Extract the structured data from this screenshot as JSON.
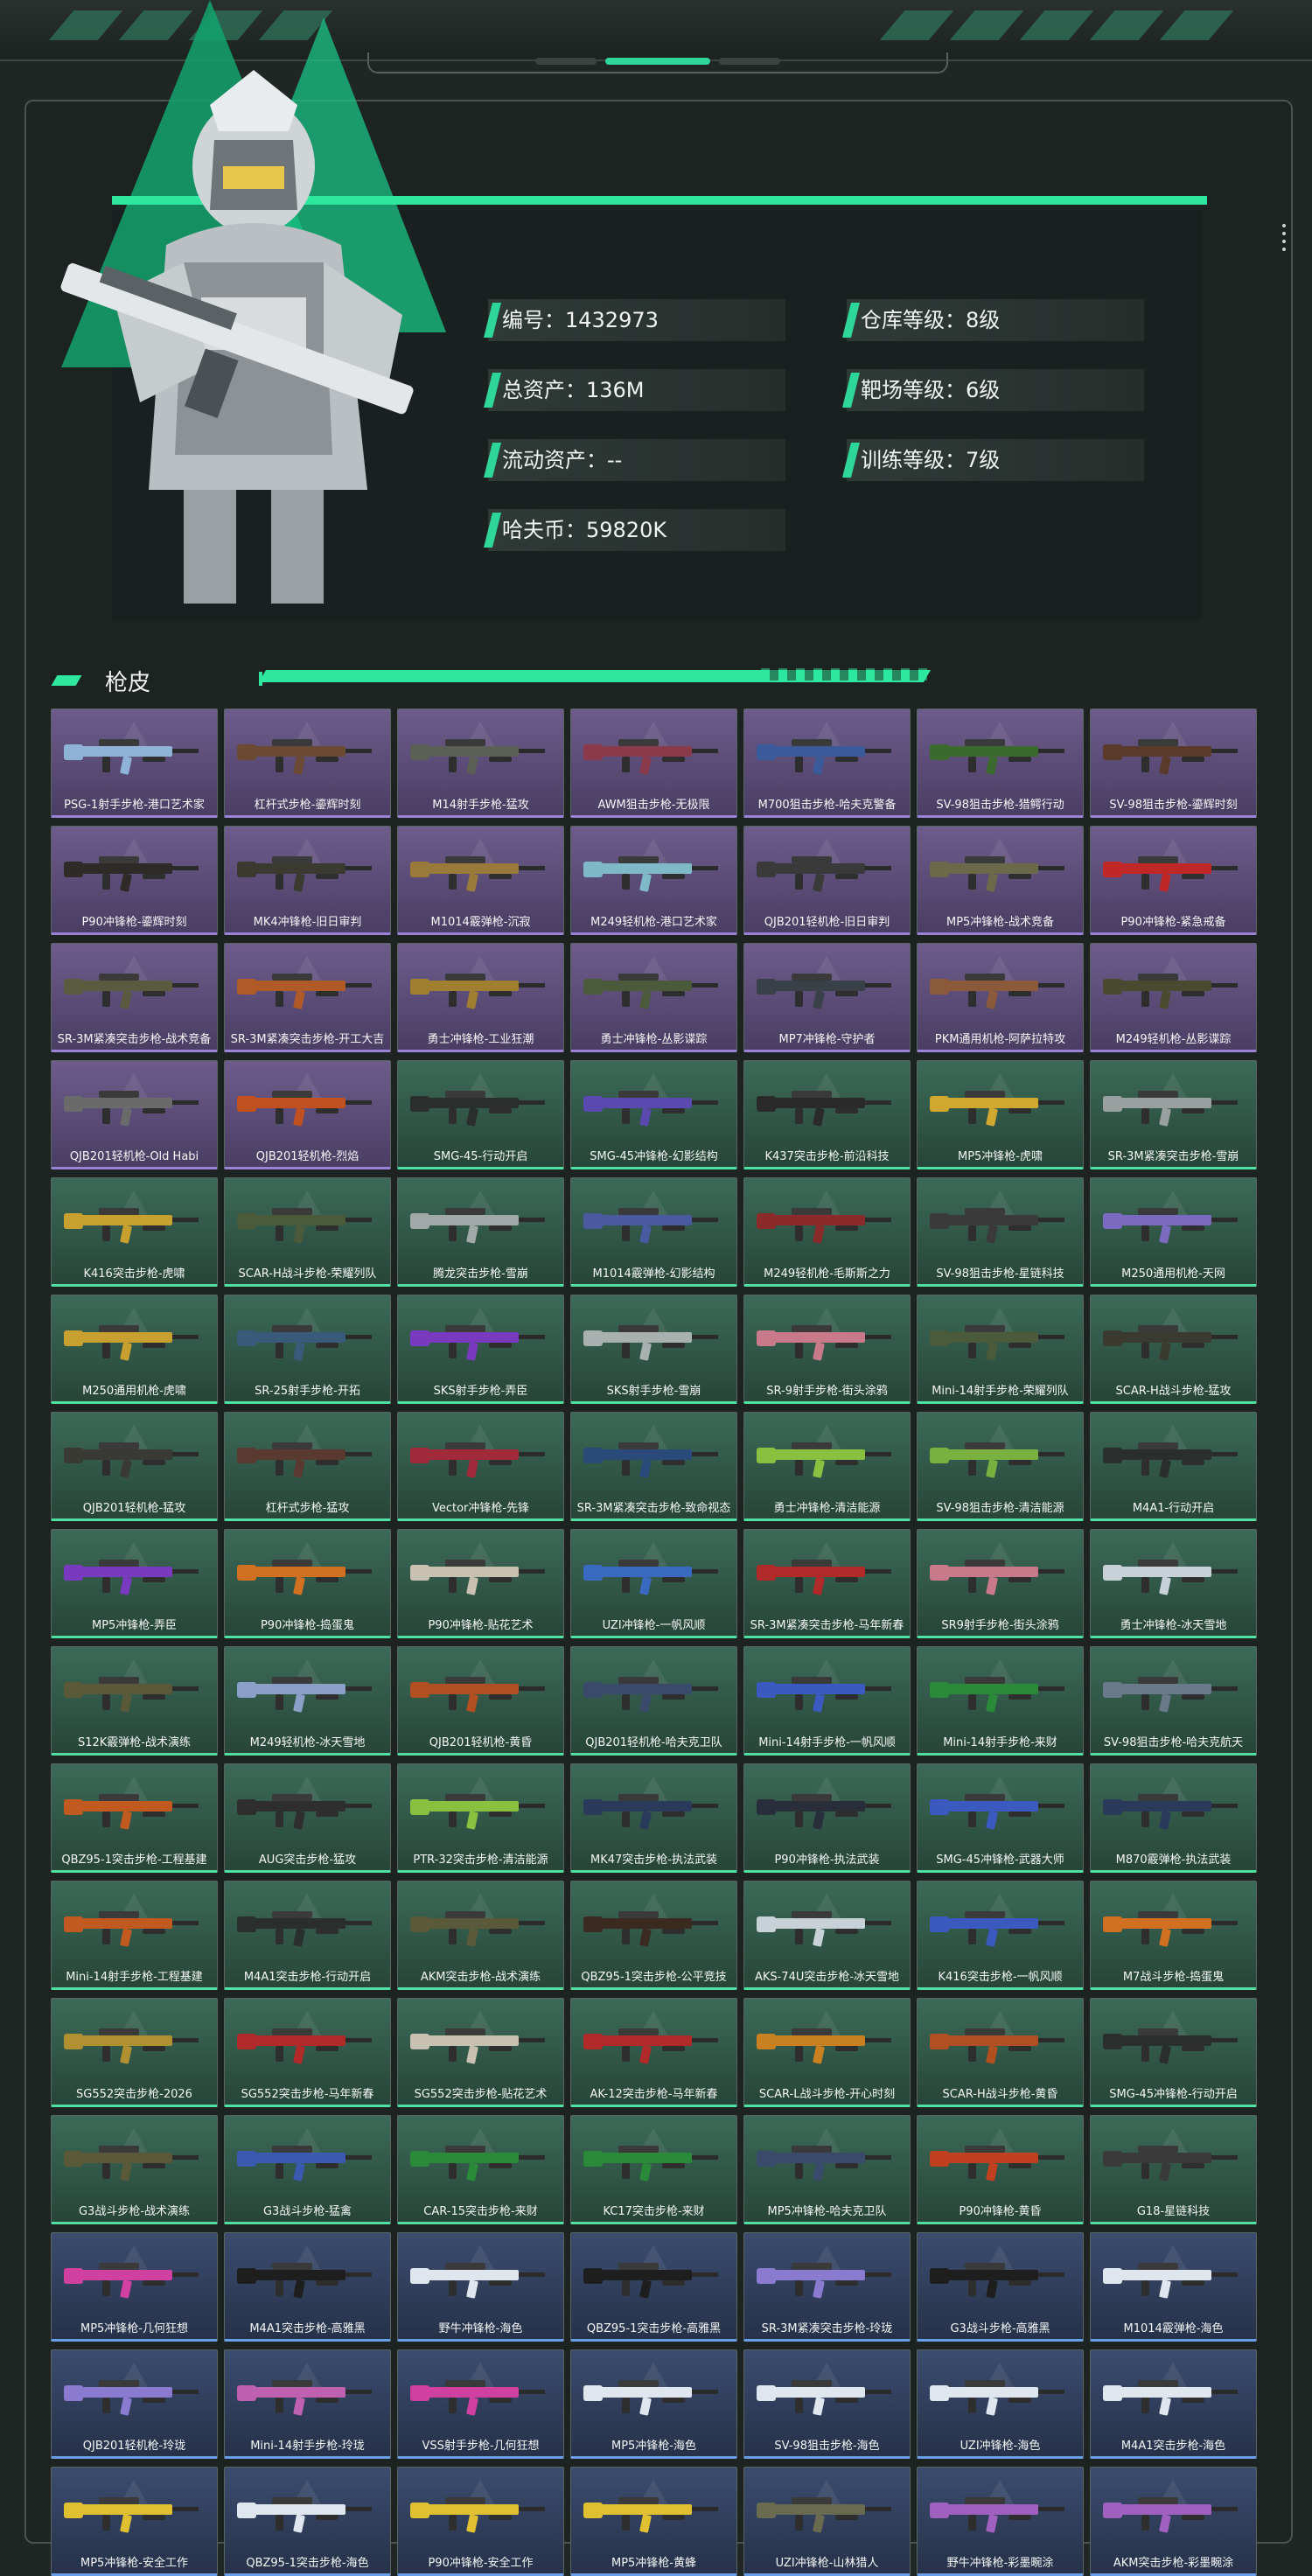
{
  "profile": {
    "id_label": "编号：1432973",
    "total_assets_label": "总资产：136M",
    "liquid_assets_label": "流动资产：--",
    "hafu_coin_label": "哈夫币：59820K",
    "warehouse_level_label": "仓库等级：8级",
    "range_level_label": "靶场等级：6级",
    "training_level_label": "训练等级：7级"
  },
  "section": {
    "title": "枪皮"
  },
  "colors": {
    "accent": "#2ee8a0",
    "purple_card": "#6d5c8c",
    "green_card": "#3c6a58",
    "blue_card": "#3b4c6e"
  },
  "skins": [
    {
      "name": "PSG-1射手步枪-港口艺术家",
      "rarity": "purple",
      "color": "#8fb3d6"
    },
    {
      "name": "杠杆式步枪-鎏辉时刻",
      "rarity": "purple",
      "color": "#6b4a33"
    },
    {
      "name": "M14射手步枪-猛攻",
      "rarity": "purple",
      "color": "#5b5f56"
    },
    {
      "name": "AWM狙击步枪-无极限",
      "rarity": "purple",
      "color": "#8a3a4a"
    },
    {
      "name": "M700狙击步枪-哈夫克警备",
      "rarity": "purple",
      "color": "#3b5a9a"
    },
    {
      "name": "SV-98狙击步枪-猎鳄行动",
      "rarity": "purple",
      "color": "#3c6a2e"
    },
    {
      "name": "SV-98狙击步枪-鎏辉时刻",
      "rarity": "purple",
      "color": "#5a3a2a"
    },
    {
      "name": "P90冲锋枪-鎏辉时刻",
      "rarity": "purple",
      "color": "#2e2a28"
    },
    {
      "name": "MK4冲锋枪-旧日审判",
      "rarity": "purple",
      "color": "#3b3a30"
    },
    {
      "name": "M1014霰弹枪-沉寂",
      "rarity": "purple",
      "color": "#9a7a3a"
    },
    {
      "name": "M249轻机枪-港口艺术家",
      "rarity": "purple",
      "color": "#7fb9c8"
    },
    {
      "name": "QJB201轻机枪-旧日审判",
      "rarity": "purple",
      "color": "#3a3a3a"
    },
    {
      "name": "MP5冲锋枪-战术竞备",
      "rarity": "purple",
      "color": "#6a6a4a"
    },
    {
      "name": "P90冲锋枪-紧急戒备",
      "rarity": "purple",
      "color": "#c02828"
    },
    {
      "name": "SR-3M紧凑突击步枪-战术竞备",
      "rarity": "purple",
      "color": "#5a5a40"
    },
    {
      "name": "SR-3M紧凑突击步枪-开工大吉",
      "rarity": "purple",
      "color": "#b05a28"
    },
    {
      "name": "勇士冲锋枪-工业狂潮",
      "rarity": "purple",
      "color": "#a08030"
    },
    {
      "name": "勇士冲锋枪-丛影谍踪",
      "rarity": "purple",
      "color": "#4a5a3a"
    },
    {
      "name": "MP7冲锋枪-守护者",
      "rarity": "purple",
      "color": "#3a4048"
    },
    {
      "name": "PKM通用机枪-阿萨拉特攻",
      "rarity": "purple",
      "color": "#8a5a3a"
    },
    {
      "name": "M249轻机枪-丛影谍踪",
      "rarity": "purple",
      "color": "#4a4a30"
    },
    {
      "name": "QJB201轻机枪-Old Habi",
      "rarity": "purple",
      "color": "#6a6a6a"
    },
    {
      "name": "QJB201轻机枪-烈焰",
      "rarity": "purple",
      "color": "#c05020"
    },
    {
      "name": "SMG-45-行动开启",
      "rarity": "green",
      "color": "#2a2e2c"
    },
    {
      "name": "SMG-45冲锋枪-幻影结构",
      "rarity": "green",
      "color": "#5a4ab0"
    },
    {
      "name": "K437突击步枪-前沿科技",
      "rarity": "green",
      "color": "#2a2a2a"
    },
    {
      "name": "MP5冲锋枪-虎啸",
      "rarity": "green",
      "color": "#d0a830"
    },
    {
      "name": "SR-3M紧凑突击步枪-雪崩",
      "rarity": "green",
      "color": "#9aa0a0"
    },
    {
      "name": "K416突击步枪-虎啸",
      "rarity": "green",
      "color": "#c8a030"
    },
    {
      "name": "SCAR-H战斗步枪-荣耀列队",
      "rarity": "green",
      "color": "#4a5a3a"
    },
    {
      "name": "腾龙突击步枪-雪崩",
      "rarity": "green",
      "color": "#a0a8a8"
    },
    {
      "name": "M1014霰弹枪-幻影结构",
      "rarity": "green",
      "color": "#4a5aa0"
    },
    {
      "name": "M249轻机枪-毛斯斯之力",
      "rarity": "green",
      "color": "#8a2a2a"
    },
    {
      "name": "SV-98狙击步枪-星链科技",
      "rarity": "green",
      "color": "#3a3a3a"
    },
    {
      "name": "M250通用机枪-天网",
      "rarity": "green",
      "color": "#7a6ac0"
    },
    {
      "name": "M250通用机枪-虎啸",
      "rarity": "green",
      "color": "#c8a030"
    },
    {
      "name": "SR-25射手步枪-开拓",
      "rarity": "green",
      "color": "#3a5a7a"
    },
    {
      "name": "SKS射手步枪-弄臣",
      "rarity": "green",
      "color": "#7a3ac0"
    },
    {
      "name": "SKS射手步枪-雪崩",
      "rarity": "green",
      "color": "#a8b0b0"
    },
    {
      "name": "SR-9射手步枪-街头涂鸦",
      "rarity": "green",
      "color": "#c87a8a"
    },
    {
      "name": "Mini-14射手步枪-荣耀列队",
      "rarity": "green",
      "color": "#4a5a3a"
    },
    {
      "name": "SCAR-H战斗步枪-猛攻",
      "rarity": "green",
      "color": "#3a3a30"
    },
    {
      "name": "QJB201轻机枪-猛攻",
      "rarity": "green",
      "color": "#3a3a34"
    },
    {
      "name": "杠杆式步枪-猛攻",
      "rarity": "green",
      "color": "#5a3a30"
    },
    {
      "name": "Vector冲锋枪-先锋",
      "rarity": "green",
      "color": "#a02a3a"
    },
    {
      "name": "SR-3M紧凑突击步枪-致命视态",
      "rarity": "green",
      "color": "#2a4a7a"
    },
    {
      "name": "勇士冲锋枪-清洁能源",
      "rarity": "green",
      "color": "#8ac040"
    },
    {
      "name": "SV-98狙击步枪-清洁能源",
      "rarity": "green",
      "color": "#7ab040"
    },
    {
      "name": "M4A1-行动开启",
      "rarity": "green",
      "color": "#2a2e2c"
    },
    {
      "name": "MP5冲锋枪-弄臣",
      "rarity": "green",
      "color": "#7a3ac0"
    },
    {
      "name": "P90冲锋枪-捣蛋鬼",
      "rarity": "green",
      "color": "#d07020"
    },
    {
      "name": "P90冲锋枪-贴花艺术",
      "rarity": "green",
      "color": "#c8c0b0"
    },
    {
      "name": "UZI冲锋枪-一帆风顺",
      "rarity": "green",
      "color": "#3a6ac0"
    },
    {
      "name": "SR-3M紧凑突击步枪-马年新春",
      "rarity": "green",
      "color": "#b02a2a"
    },
    {
      "name": "SR9射手步枪-街头涂鸦",
      "rarity": "green",
      "color": "#c87a8a"
    },
    {
      "name": "勇士冲锋枪-冰天雪地",
      "rarity": "green",
      "color": "#c8d0d8"
    },
    {
      "name": "S12K霰弹枪-战术演练",
      "rarity": "green",
      "color": "#5a5a3a"
    },
    {
      "name": "M249轻机枪-冰天雪地",
      "rarity": "green",
      "color": "#8aa0c8"
    },
    {
      "name": "QJB201轻机枪-黄昏",
      "rarity": "green",
      "color": "#b05020"
    },
    {
      "name": "QJB201轻机枪-哈夫克卫队",
      "rarity": "green",
      "color": "#3a4a6a"
    },
    {
      "name": "Mini-14射手步枪-一帆风顺",
      "rarity": "green",
      "color": "#3a5ac0"
    },
    {
      "name": "Mini-14射手步枪-来财",
      "rarity": "green",
      "color": "#2a8a3a"
    },
    {
      "name": "SV-98狙击步枪-哈夫克航天",
      "rarity": "green",
      "color": "#6a7a8a"
    },
    {
      "name": "QBZ95-1突击步枪-工程基建",
      "rarity": "green",
      "color": "#c05a20"
    },
    {
      "name": "AUG突击步枪-猛攻",
      "rarity": "green",
      "color": "#2e2e2e"
    },
    {
      "name": "PTR-32突击步枪-清洁能源",
      "rarity": "green",
      "color": "#8ac040"
    },
    {
      "name": "MK47突击步枪-执法武装",
      "rarity": "green",
      "color": "#2a3a5a"
    },
    {
      "name": "P90冲锋枪-执法武装",
      "rarity": "green",
      "color": "#2a2e3a"
    },
    {
      "name": "SMG-45冲锋枪-武器大师",
      "rarity": "green",
      "color": "#3a5ac0"
    },
    {
      "name": "M870霰弹枪-执法武装",
      "rarity": "green",
      "color": "#2a3a5a"
    },
    {
      "name": "Mini-14射手步枪-工程基建",
      "rarity": "green",
      "color": "#c05a20"
    },
    {
      "name": "M4A1突击步枪-行动开启",
      "rarity": "green",
      "color": "#2a2e2c"
    },
    {
      "name": "AKM突击步枪-战术演练",
      "rarity": "green",
      "color": "#5a5a3a"
    },
    {
      "name": "QBZ95-1突击步枪-公平竞技",
      "rarity": "green",
      "color": "#3a2a20"
    },
    {
      "name": "AKS-74U突击步枪-冰天雪地",
      "rarity": "green",
      "color": "#c8d0d8"
    },
    {
      "name": "K416突击步枪-一帆风顺",
      "rarity": "green",
      "color": "#3a5ac0"
    },
    {
      "name": "M7战斗步枪-捣蛋鬼",
      "rarity": "green",
      "color": "#d07020"
    },
    {
      "name": "SG552突击步枪-2026",
      "rarity": "green",
      "color": "#b09030"
    },
    {
      "name": "SG552突击步枪-马年新春",
      "rarity": "green",
      "color": "#b02a2a"
    },
    {
      "name": "SG552突击步枪-贴花艺术",
      "rarity": "green",
      "color": "#c8c0b0"
    },
    {
      "name": "AK-12突击步枪-马年新春",
      "rarity": "green",
      "color": "#b02a2a"
    },
    {
      "name": "SCAR-L战斗步枪-开心时刻",
      "rarity": "green",
      "color": "#c88020"
    },
    {
      "name": "SCAR-H战斗步枪-黄昏",
      "rarity": "green",
      "color": "#b05020"
    },
    {
      "name": "SMG-45冲锋枪-行动开启",
      "rarity": "green",
      "color": "#2a2e2c"
    },
    {
      "name": "G3战斗步枪-战术演练",
      "rarity": "green",
      "color": "#5a5a3a"
    },
    {
      "name": "G3战斗步枪-猛禽",
      "rarity": "green",
      "color": "#3a5ab0"
    },
    {
      "name": "CAR-15突击步枪-来财",
      "rarity": "green",
      "color": "#2a8a3a"
    },
    {
      "name": "KC17突击步枪-来财",
      "rarity": "green",
      "color": "#2a8a3a"
    },
    {
      "name": "MP5冲锋枪-哈夫克卫队",
      "rarity": "green",
      "color": "#3a4a6a"
    },
    {
      "name": "P90冲锋枪-黄昏",
      "rarity": "green",
      "color": "#c04020"
    },
    {
      "name": "G18-星链科技",
      "rarity": "green",
      "color": "#3a3a3a"
    },
    {
      "name": "MP5冲锋枪-几何狂想",
      "rarity": "blue",
      "color": "#d040a0"
    },
    {
      "name": "M4A1突击步枪-高雅黑",
      "rarity": "blue",
      "color": "#1e1e1e"
    },
    {
      "name": "野牛冲锋枪-海色",
      "rarity": "blue",
      "color": "#dfe6ee"
    },
    {
      "name": "QBZ95-1突击步枪-高雅黑",
      "rarity": "blue",
      "color": "#1e1e1e"
    },
    {
      "name": "SR-3M紧凑突击步枪-玲珑",
      "rarity": "blue",
      "color": "#8a7ad0"
    },
    {
      "name": "G3战斗步枪-高雅黑",
      "rarity": "blue",
      "color": "#1e1e1e"
    },
    {
      "name": "M1014霰弹枪-海色",
      "rarity": "blue",
      "color": "#dfe6ee"
    },
    {
      "name": "QJB201轻机枪-玲珑",
      "rarity": "blue",
      "color": "#8a7ad0"
    },
    {
      "name": "Mini-14射手步枪-玲珑",
      "rarity": "blue",
      "color": "#c060b0"
    },
    {
      "name": "VSS射手步枪-几何狂想",
      "rarity": "blue",
      "color": "#d040a0"
    },
    {
      "name": "MP5冲锋枪-海色",
      "rarity": "blue",
      "color": "#dfe6ee"
    },
    {
      "name": "SV-98狙击步枪-海色",
      "rarity": "blue",
      "color": "#dfe6ee"
    },
    {
      "name": "UZI冲锋枪-海色",
      "rarity": "blue",
      "color": "#dfe6ee"
    },
    {
      "name": "M4A1突击步枪-海色",
      "rarity": "blue",
      "color": "#dfe6ee"
    },
    {
      "name": "MP5冲锋枪-安全工作",
      "rarity": "blue",
      "color": "#e0c030"
    },
    {
      "name": "QBZ95-1突击步枪-海色",
      "rarity": "blue",
      "color": "#dfe6ee"
    },
    {
      "name": "P90冲锋枪-安全工作",
      "rarity": "blue",
      "color": "#e0c030"
    },
    {
      "name": "MP5冲锋枪-黄蜂",
      "rarity": "blue",
      "color": "#e0c030"
    },
    {
      "name": "UZI冲锋枪-山林猎人",
      "rarity": "blue",
      "color": "#6a6a50"
    },
    {
      "name": "野牛冲锋枪-彩墨畹涂",
      "rarity": "blue",
      "color": "#a060c0"
    },
    {
      "name": "AKM突击步枪-彩墨畹涂",
      "rarity": "blue",
      "color": "#a060c0"
    }
  ]
}
